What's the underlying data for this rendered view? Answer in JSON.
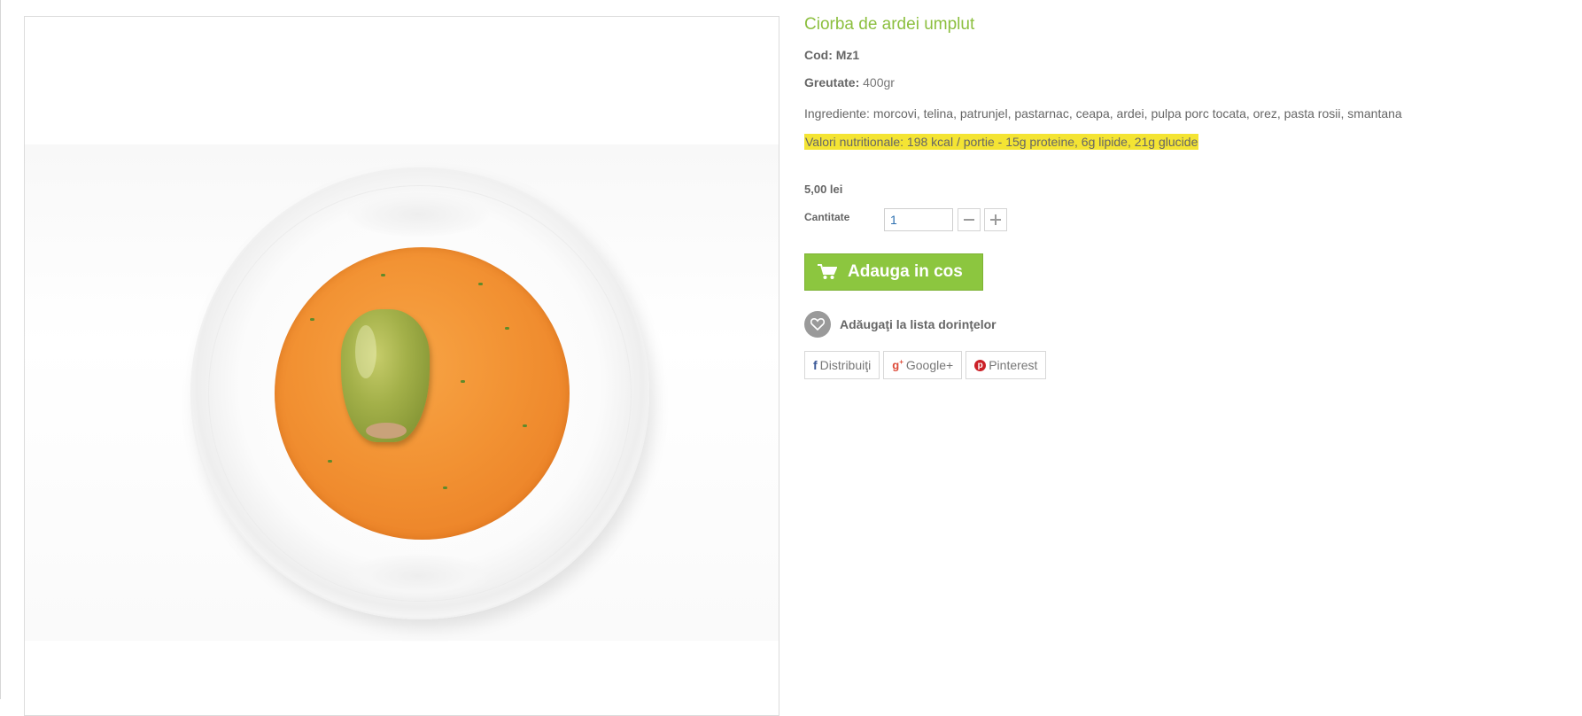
{
  "product": {
    "title": "Ciorba de ardei umplut",
    "code_label": "Cod: Mz1",
    "weight_label": "Greutate:",
    "weight_value": "400gr",
    "ingredients": "Ingrediente: morcovi, telina, patrunjel, pastarnac, ceapa, ardei, pulpa porc tocata, orez, pasta rosii, smantana",
    "nutrition": "Valori nutritionale: 198 kcal / portie - 15g proteine, 6g lipide, 21g glucide",
    "price": "5,00 lei"
  },
  "quantity": {
    "label": "Cantitate",
    "value": "1"
  },
  "actions": {
    "add_to_cart": "Adauga in cos",
    "wishlist": "Adăugaţi la lista dorinţelor"
  },
  "share": {
    "facebook": "Distribuiţi",
    "google": "Google+",
    "pinterest": "Pinterest"
  },
  "colors": {
    "accent": "#8cc63f",
    "title": "#8cbf3f",
    "highlight": "#f4e433"
  },
  "icons": {
    "cart": "shopping-cart-icon",
    "heart": "heart-icon",
    "minus": "minus-icon",
    "plus": "plus-icon",
    "facebook": "facebook-icon",
    "google": "google-plus-icon",
    "pinterest": "pinterest-icon"
  }
}
